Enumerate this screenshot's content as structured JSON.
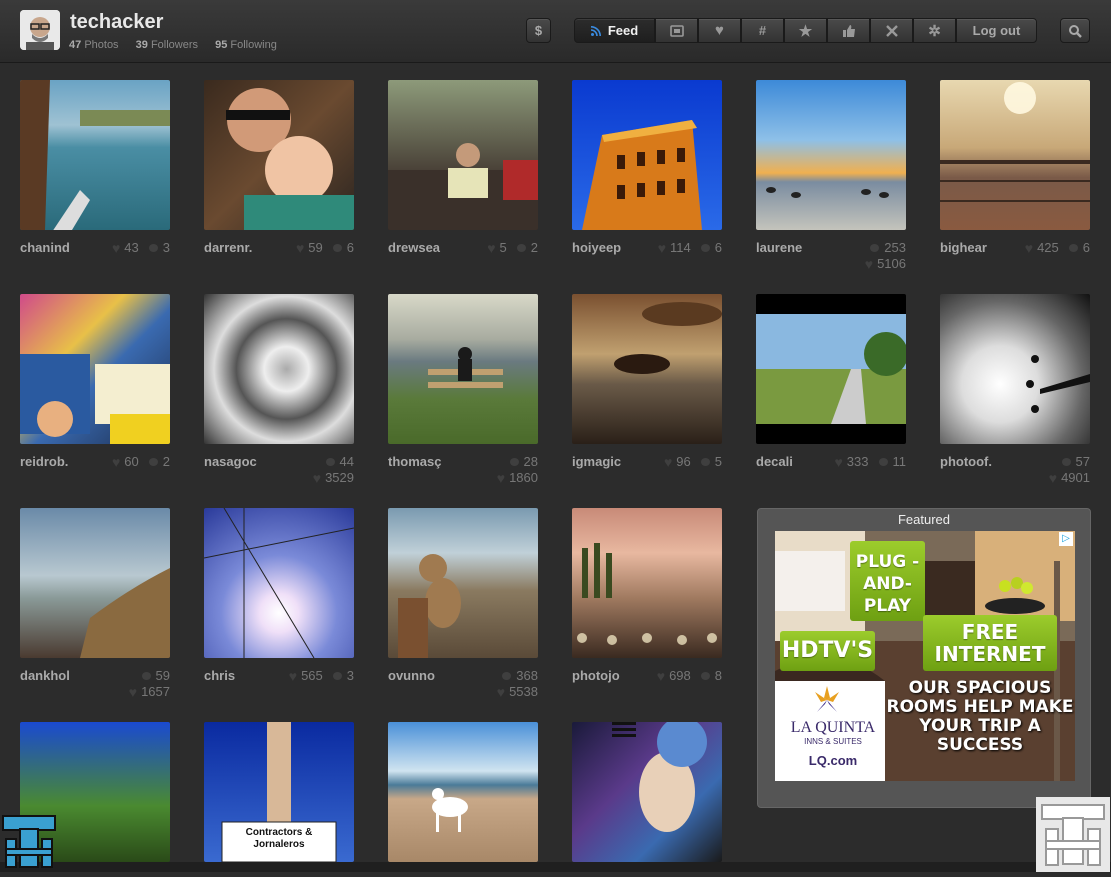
{
  "user": {
    "name": "techacker",
    "photos_count": "47",
    "photos_label": "Photos",
    "followers_count": "39",
    "followers_label": "Followers",
    "following_count": "95",
    "following_label": "Following"
  },
  "toolbar": {
    "dollar_icon": "$",
    "feed_label": "Feed",
    "hash_icon": "#",
    "star_icon": "★",
    "logout_label": "Log out"
  },
  "photos": [
    {
      "user": "chanind",
      "likes": "43",
      "comments": "3"
    },
    {
      "user": "darrenr.",
      "likes": "59",
      "comments": "6"
    },
    {
      "user": "drewsea",
      "likes": "5",
      "comments": "2"
    },
    {
      "user": "hoiyeep",
      "likes": "114",
      "comments": "6"
    },
    {
      "user": "laurene",
      "comments": "253",
      "likes": "5106"
    },
    {
      "user": "bighear",
      "likes": "425",
      "comments": "6"
    },
    {
      "user": "reidrob.",
      "likes": "60",
      "comments": "2"
    },
    {
      "user": "nasagoc",
      "comments": "44",
      "likes": "3529"
    },
    {
      "user": "thomasç",
      "comments": "28",
      "likes": "1860"
    },
    {
      "user": "igmagic",
      "likes": "96",
      "comments": "5"
    },
    {
      "user": "decali",
      "likes": "333",
      "comments": "11"
    },
    {
      "user": "photoof.",
      "comments": "57",
      "likes": "4901"
    },
    {
      "user": "dankhol",
      "comments": "59",
      "likes": "1657"
    },
    {
      "user": "chris",
      "likes": "565",
      "comments": "3"
    },
    {
      "user": "ovunno",
      "comments": "368",
      "likes": "5538"
    },
    {
      "user": "photojo",
      "likes": "698",
      "comments": "8"
    }
  ],
  "featured": {
    "title": "Featured",
    "ad": {
      "bubble1": "PLUG -AND- PLAY",
      "bubble2": "HDTV'S",
      "bubble3": "FREE INTERNET",
      "tagline": "OUR SPACIOUS ROOMS HELP MAKE YOUR TRIP A SUCCESS",
      "brand": "LA QUINTA",
      "brand_sub": "INNS & SUITES",
      "url": "LQ.com",
      "badge": "▷"
    }
  },
  "colors": {
    "background": "#2c2c2c",
    "header": "#333333",
    "ad_green": "#8bbd20"
  }
}
